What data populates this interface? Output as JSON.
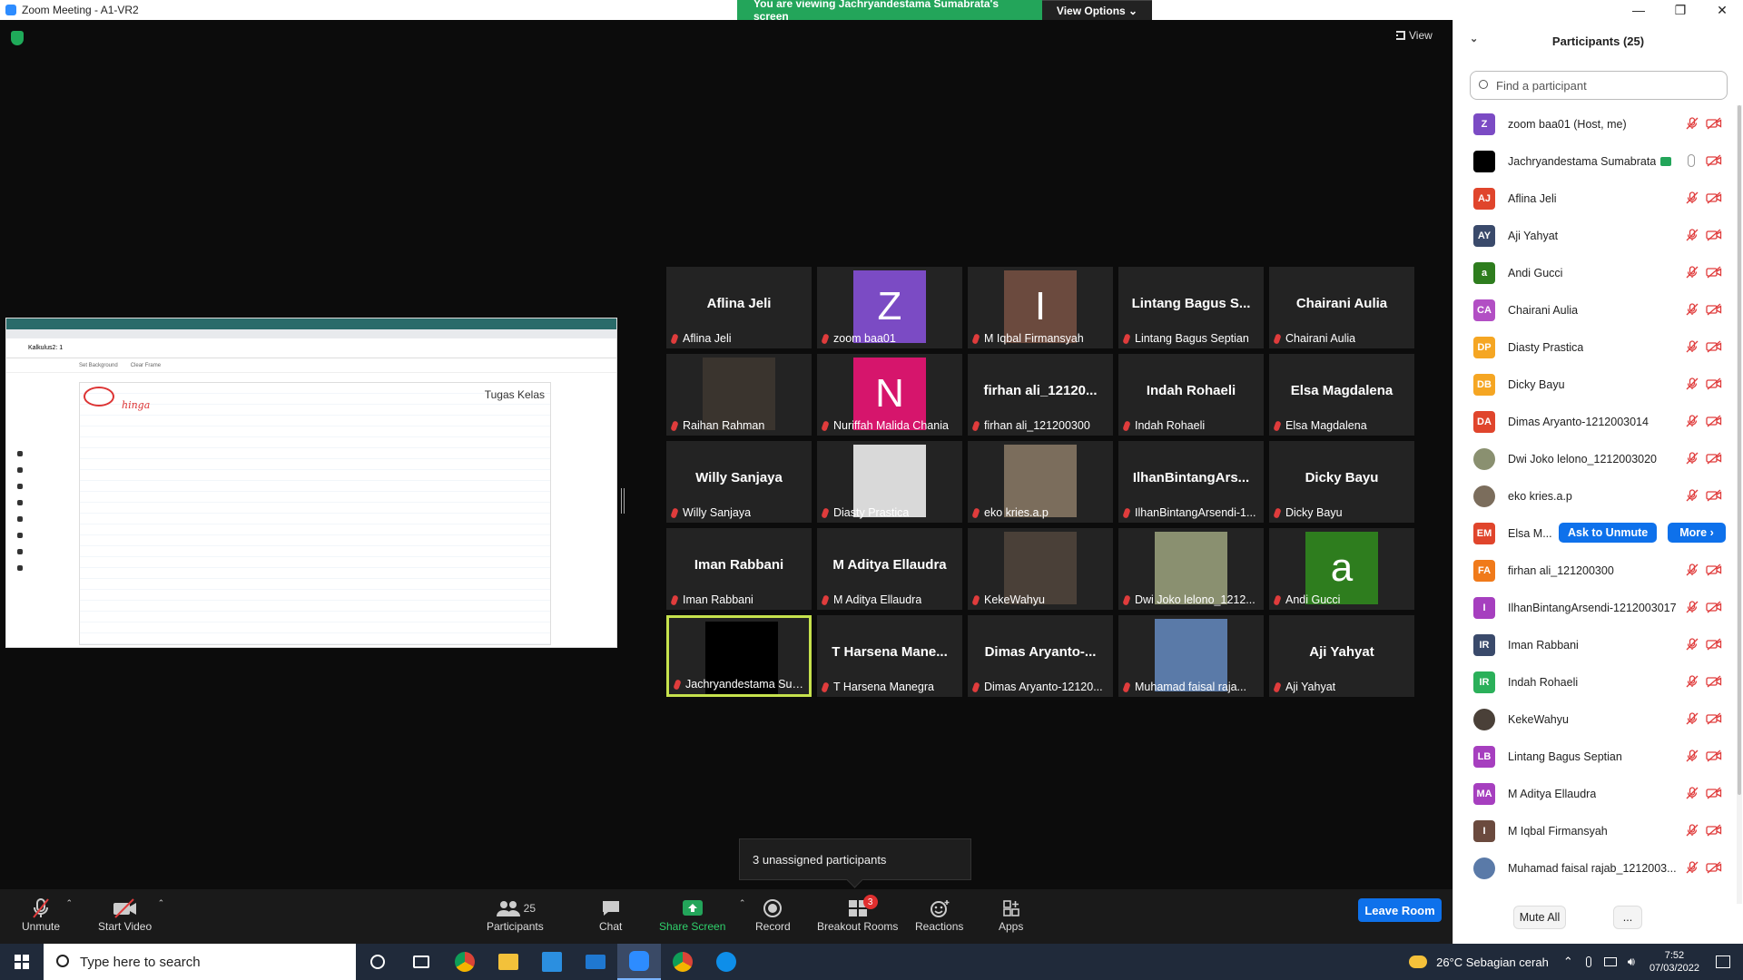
{
  "window": {
    "title": "Zoom Meeting - A1-VR2",
    "controls": [
      "—",
      "❐",
      "✕"
    ]
  },
  "banner": {
    "viewing": "You are viewing Jachryandestama Sumabrata's screen",
    "view_options": "View Options ⌄"
  },
  "main": {
    "view_label": "View",
    "shared_screen": {
      "doc_title": "Kalkulus2: 1",
      "bar_items": [
        "Set Background",
        "Clear Frame"
      ],
      "frame_title": "Tugas Kelas",
      "ink_text": "hinga"
    }
  },
  "gallery": {
    "tiles": [
      {
        "name": "Aflina Jeli",
        "label": "Aflina Jeli",
        "avatar": "",
        "color": ""
      },
      {
        "name": "",
        "label": "zoom baa01",
        "avatar": "Z",
        "color": "#7b4bc4"
      },
      {
        "name": "",
        "label": "M Iqbal Firmansyah",
        "avatar": "I",
        "color": "#6b4a3e"
      },
      {
        "name": "Lintang Bagus S...",
        "label": "Lintang Bagus Septian",
        "avatar": "",
        "color": ""
      },
      {
        "name": "Chairani Aulia",
        "label": "Chairani Aulia",
        "avatar": "",
        "color": ""
      },
      {
        "name": "",
        "label": "Raihan Rahman",
        "avatar": "",
        "color": "",
        "photo": "#3a342e"
      },
      {
        "name": "",
        "label": "Nuriffah Malida Chania",
        "avatar": "N",
        "color": "#d6156c"
      },
      {
        "name": "firhan ali_12120...",
        "label": "firhan ali_121200300",
        "avatar": "",
        "color": ""
      },
      {
        "name": "Indah Rohaeli",
        "label": "Indah Rohaeli",
        "avatar": "",
        "color": ""
      },
      {
        "name": "Elsa Magdalena",
        "label": "Elsa Magdalena",
        "avatar": "",
        "color": ""
      },
      {
        "name": "Willy Sanjaya",
        "label": "Willy Sanjaya",
        "avatar": "",
        "color": ""
      },
      {
        "name": "",
        "label": "Diasty Prastica",
        "avatar": "",
        "color": "",
        "photo": "#d9d9d9"
      },
      {
        "name": "",
        "label": "eko kries.a.p",
        "avatar": "",
        "color": "",
        "photo": "#7b6d5c"
      },
      {
        "name": "IlhanBintangArs...",
        "label": "IlhanBintangArsendi-1...",
        "avatar": "",
        "color": ""
      },
      {
        "name": "Dicky Bayu",
        "label": "Dicky Bayu",
        "avatar": "",
        "color": ""
      },
      {
        "name": "Iman Rabbani",
        "label": "Iman Rabbani",
        "avatar": "",
        "color": ""
      },
      {
        "name": "M Aditya Ellaudra",
        "label": "M Aditya Ellaudra",
        "avatar": "",
        "color": ""
      },
      {
        "name": "",
        "label": "KekeWahyu",
        "avatar": "",
        "color": "",
        "photo": "#4a4038"
      },
      {
        "name": "",
        "label": "Dwi Joko lelono_1212...",
        "avatar": "",
        "color": "",
        "photo": "#8a9070"
      },
      {
        "name": "",
        "label": "Andi Gucci",
        "avatar": "a",
        "color": "#2e7d1e"
      },
      {
        "name": "",
        "label": "Jachryandestama Sumab...",
        "avatar": "",
        "color": "",
        "photo": "#000000",
        "active": true
      },
      {
        "name": "T Harsena Mane...",
        "label": "T Harsena Manegra",
        "avatar": "",
        "color": ""
      },
      {
        "name": "Dimas Aryanto-...",
        "label": "Dimas Aryanto-12120...",
        "avatar": "",
        "color": ""
      },
      {
        "name": "",
        "label": "Muhamad faisal raja...",
        "avatar": "",
        "color": "",
        "photo": "#5a7aa8"
      },
      {
        "name": "Aji Yahyat",
        "label": "Aji Yahyat",
        "avatar": "",
        "color": ""
      }
    ],
    "toast": "3 unassigned participants"
  },
  "toolbar": {
    "unmute": "Unmute",
    "start_video": "Start Video",
    "participants": "Participants",
    "participants_count": "25",
    "chat": "Chat",
    "share_screen": "Share Screen",
    "record": "Record",
    "breakout": "Breakout Rooms",
    "breakout_badge": "3",
    "reactions": "Reactions",
    "apps": "Apps",
    "leave": "Leave Room"
  },
  "panel": {
    "title": "Participants (25)",
    "search_placeholder": "Find a participant",
    "mute_all": "Mute All",
    "more": "...",
    "ask_to_unmute": "Ask to Unmute",
    "more_btn": "More ›",
    "participants": [
      {
        "initials": "Z",
        "name": "zoom baa01 (Host, me)",
        "color": "#7b4bc4"
      },
      {
        "initials": "",
        "name": "Jachryandestama Sumabrata",
        "color": "#000000",
        "sharing": true
      },
      {
        "initials": "AJ",
        "name": "Aflina Jeli",
        "color": "#e0452c"
      },
      {
        "initials": "AY",
        "name": "Aji Yahyat",
        "color": "#3a4a6b"
      },
      {
        "initials": "a",
        "name": "Andi Gucci",
        "color": "#2e7d1e"
      },
      {
        "initials": "CA",
        "name": "Chairani Aulia",
        "color": "#b24fc4"
      },
      {
        "initials": "DP",
        "name": "Diasty Prastica",
        "color": "#f5a623"
      },
      {
        "initials": "DB",
        "name": "Dicky Bayu",
        "color": "#f5a623"
      },
      {
        "initials": "DA",
        "name": "Dimas Aryanto-1212003014",
        "color": "#e0452c"
      },
      {
        "initials": "",
        "name": "Dwi Joko lelono_1212003020",
        "color": "#8a9070"
      },
      {
        "initials": "",
        "name": "eko kries.a.p",
        "color": "#7b6d5c"
      },
      {
        "initials": "EM",
        "name": "Elsa M...",
        "color": "#e0452c",
        "hover": true
      },
      {
        "initials": "FA",
        "name": "firhan ali_121200300",
        "color": "#f07a1a"
      },
      {
        "initials": "I",
        "name": "IlhanBintangArsendi-1212003017",
        "color": "#a63fbf"
      },
      {
        "initials": "IR",
        "name": "Iman Rabbani",
        "color": "#3a4a6b"
      },
      {
        "initials": "IR",
        "name": "Indah Rohaeli",
        "color": "#2bb05a"
      },
      {
        "initials": "",
        "name": "KekeWahyu",
        "color": "#4a4038"
      },
      {
        "initials": "LB",
        "name": "Lintang Bagus Septian",
        "color": "#a63fbf"
      },
      {
        "initials": "MA",
        "name": "M Aditya Ellaudra",
        "color": "#a63fbf"
      },
      {
        "initials": "I",
        "name": "M Iqbal Firmansyah",
        "color": "#6b4a3e"
      },
      {
        "initials": "",
        "name": "Muhamad faisal rajab_1212003...",
        "color": "#5a7aa8"
      }
    ]
  },
  "taskbar": {
    "search_placeholder": "Type here to search",
    "weather": "26°C  Sebagian cerah",
    "time": "7:52",
    "date": "07/03/2022"
  }
}
